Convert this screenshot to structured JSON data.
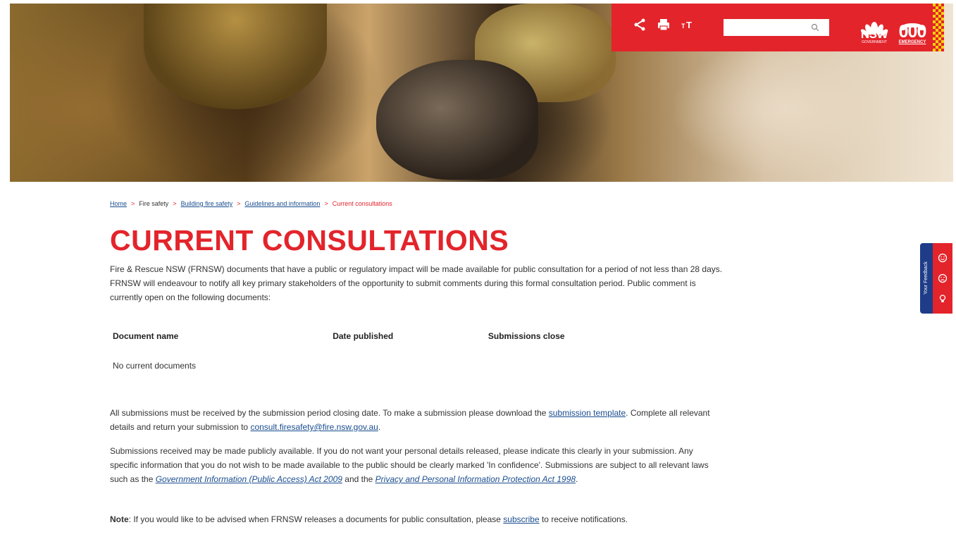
{
  "header": {
    "search": {
      "placeholder": "",
      "value": ""
    },
    "icons": [
      "share-icon",
      "print-icon",
      "text-size-icon",
      "search-icon"
    ],
    "nsw_logo": {
      "label": "NSW",
      "sub": "GOVERNMENT"
    },
    "emergency_logo": {
      "label": "000",
      "sub": "EMERGENCY"
    },
    "colors": {
      "brand_red": "#e3242b",
      "checker_yellow": "#f5d20a",
      "feedback_blue": "#1f3c88",
      "link_blue": "#1a4d8f"
    }
  },
  "breadcrumb": {
    "home": "Home",
    "fire_safety": "Fire safety",
    "building_fire_safety": "Building fire safety",
    "guidelines": "Guidelines and information",
    "current": "Current consultations",
    "separator": ">"
  },
  "page_title": "CURRENT CONSULTATIONS",
  "intro": "Fire & Rescue NSW (FRNSW) documents that have a public or regulatory impact will be made available for public consultation for a period of not less than 28 days. FRNSW will endeavour to notify all key primary stakeholders of the opportunity to submit comments during this formal consultation period. Public comment is currently open on the following documents:",
  "table": {
    "columns": [
      "Document name",
      "Date published",
      "Submissions close"
    ],
    "empty_text": "No current documents"
  },
  "submissions": {
    "text_before_link": "All submissions must be received by the submission period closing date. To make a submission please download the ",
    "template_link": "submission template",
    "text_mid": ". Complete all relevant details and return your submission to ",
    "email_link": "consult.firesafety@fire.nsw.gov.au",
    "text_end": "."
  },
  "privacy": {
    "text_1": "Submissions received may be made publicly available. If you do not want your personal details released, please indicate this clearly in your submission. Any specific information that you do not wish to be made available to the public should be clearly marked 'In confidence'. Submissions are subject to all relevant laws such as the ",
    "gipa_link": "Government Information (Public Access) Act 2009",
    "text_2": " and the ",
    "ppip_link": "Privacy and Personal Information Protection Act 1998",
    "text_3": "."
  },
  "note": {
    "label": "Note",
    "text_1": ": If you would like to be advised when FRNSW releases a documents for public consultation, please ",
    "subscribe_link": "subscribe",
    "text_2": " to receive notifications."
  },
  "feedback": {
    "label": "Your Feedback",
    "icons": [
      "happy-face-icon",
      "sad-face-icon",
      "lightbulb-icon"
    ]
  }
}
